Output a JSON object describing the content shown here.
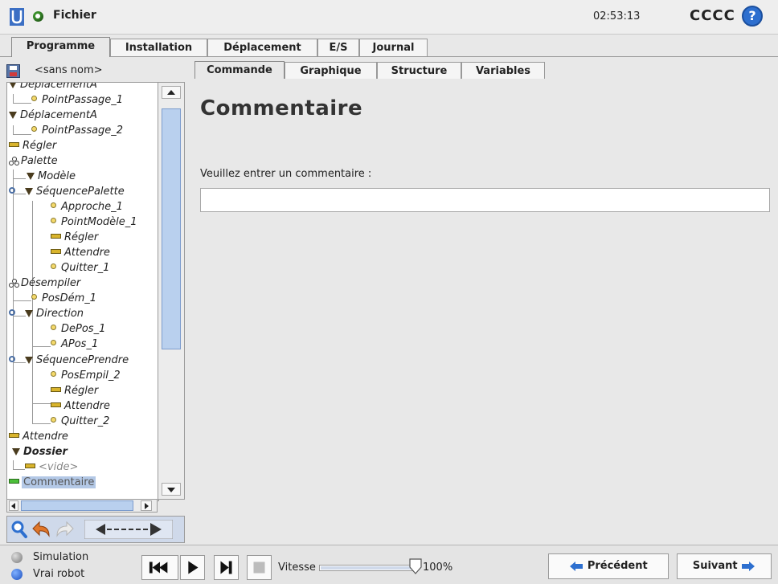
{
  "topbar": {
    "file_label": "Fichier",
    "clock": "02:53:13",
    "robot_name": "CCCC",
    "help_label": "?"
  },
  "main_tabs": [
    "Programme",
    "Installation",
    "Déplacement",
    "E/S",
    "Journal"
  ],
  "program_name": "<sans nom>",
  "sub_tabs": [
    "Commande",
    "Graphique",
    "Structure",
    "Variables"
  ],
  "tree": {
    "nodes": [
      {
        "label": "DéplacementA"
      },
      {
        "label": "PointPassage_1"
      },
      {
        "label": "DéplacementA"
      },
      {
        "label": "PointPassage_2"
      },
      {
        "label": "Régler"
      },
      {
        "label": "Palette"
      },
      {
        "label": "Modèle"
      },
      {
        "label": "SéquencePalette"
      },
      {
        "label": "Approche_1"
      },
      {
        "label": "PointModèle_1"
      },
      {
        "label": "Régler"
      },
      {
        "label": "Attendre"
      },
      {
        "label": "Quitter_1"
      },
      {
        "label": "Désempiler"
      },
      {
        "label": "PosDém_1"
      },
      {
        "label": "Direction"
      },
      {
        "label": "DePos_1"
      },
      {
        "label": "APos_1"
      },
      {
        "label": "SéquencePrendre"
      },
      {
        "label": "PosEmpil_2"
      },
      {
        "label": "Régler"
      },
      {
        "label": "Attendre"
      },
      {
        "label": "Quitter_2"
      },
      {
        "label": "Attendre"
      },
      {
        "label": "Dossier"
      },
      {
        "label": "<vide>"
      },
      {
        "label": "Commentaire"
      }
    ]
  },
  "content": {
    "title": "Commentaire",
    "prompt": "Veuillez entrer un commentaire :",
    "comment_value": ""
  },
  "footer": {
    "simulation_label": "Simulation",
    "real_robot_label": "Vrai robot",
    "speed_label": "Vitesse",
    "speed_value": "100%",
    "speed_fraction": 1.0,
    "previous_label": "Précédent",
    "next_label": "Suivant"
  },
  "colors": {
    "accent_blue": "#2d6fcf",
    "selection": "#b3c8e6",
    "status_green": "#3a8f2a"
  }
}
